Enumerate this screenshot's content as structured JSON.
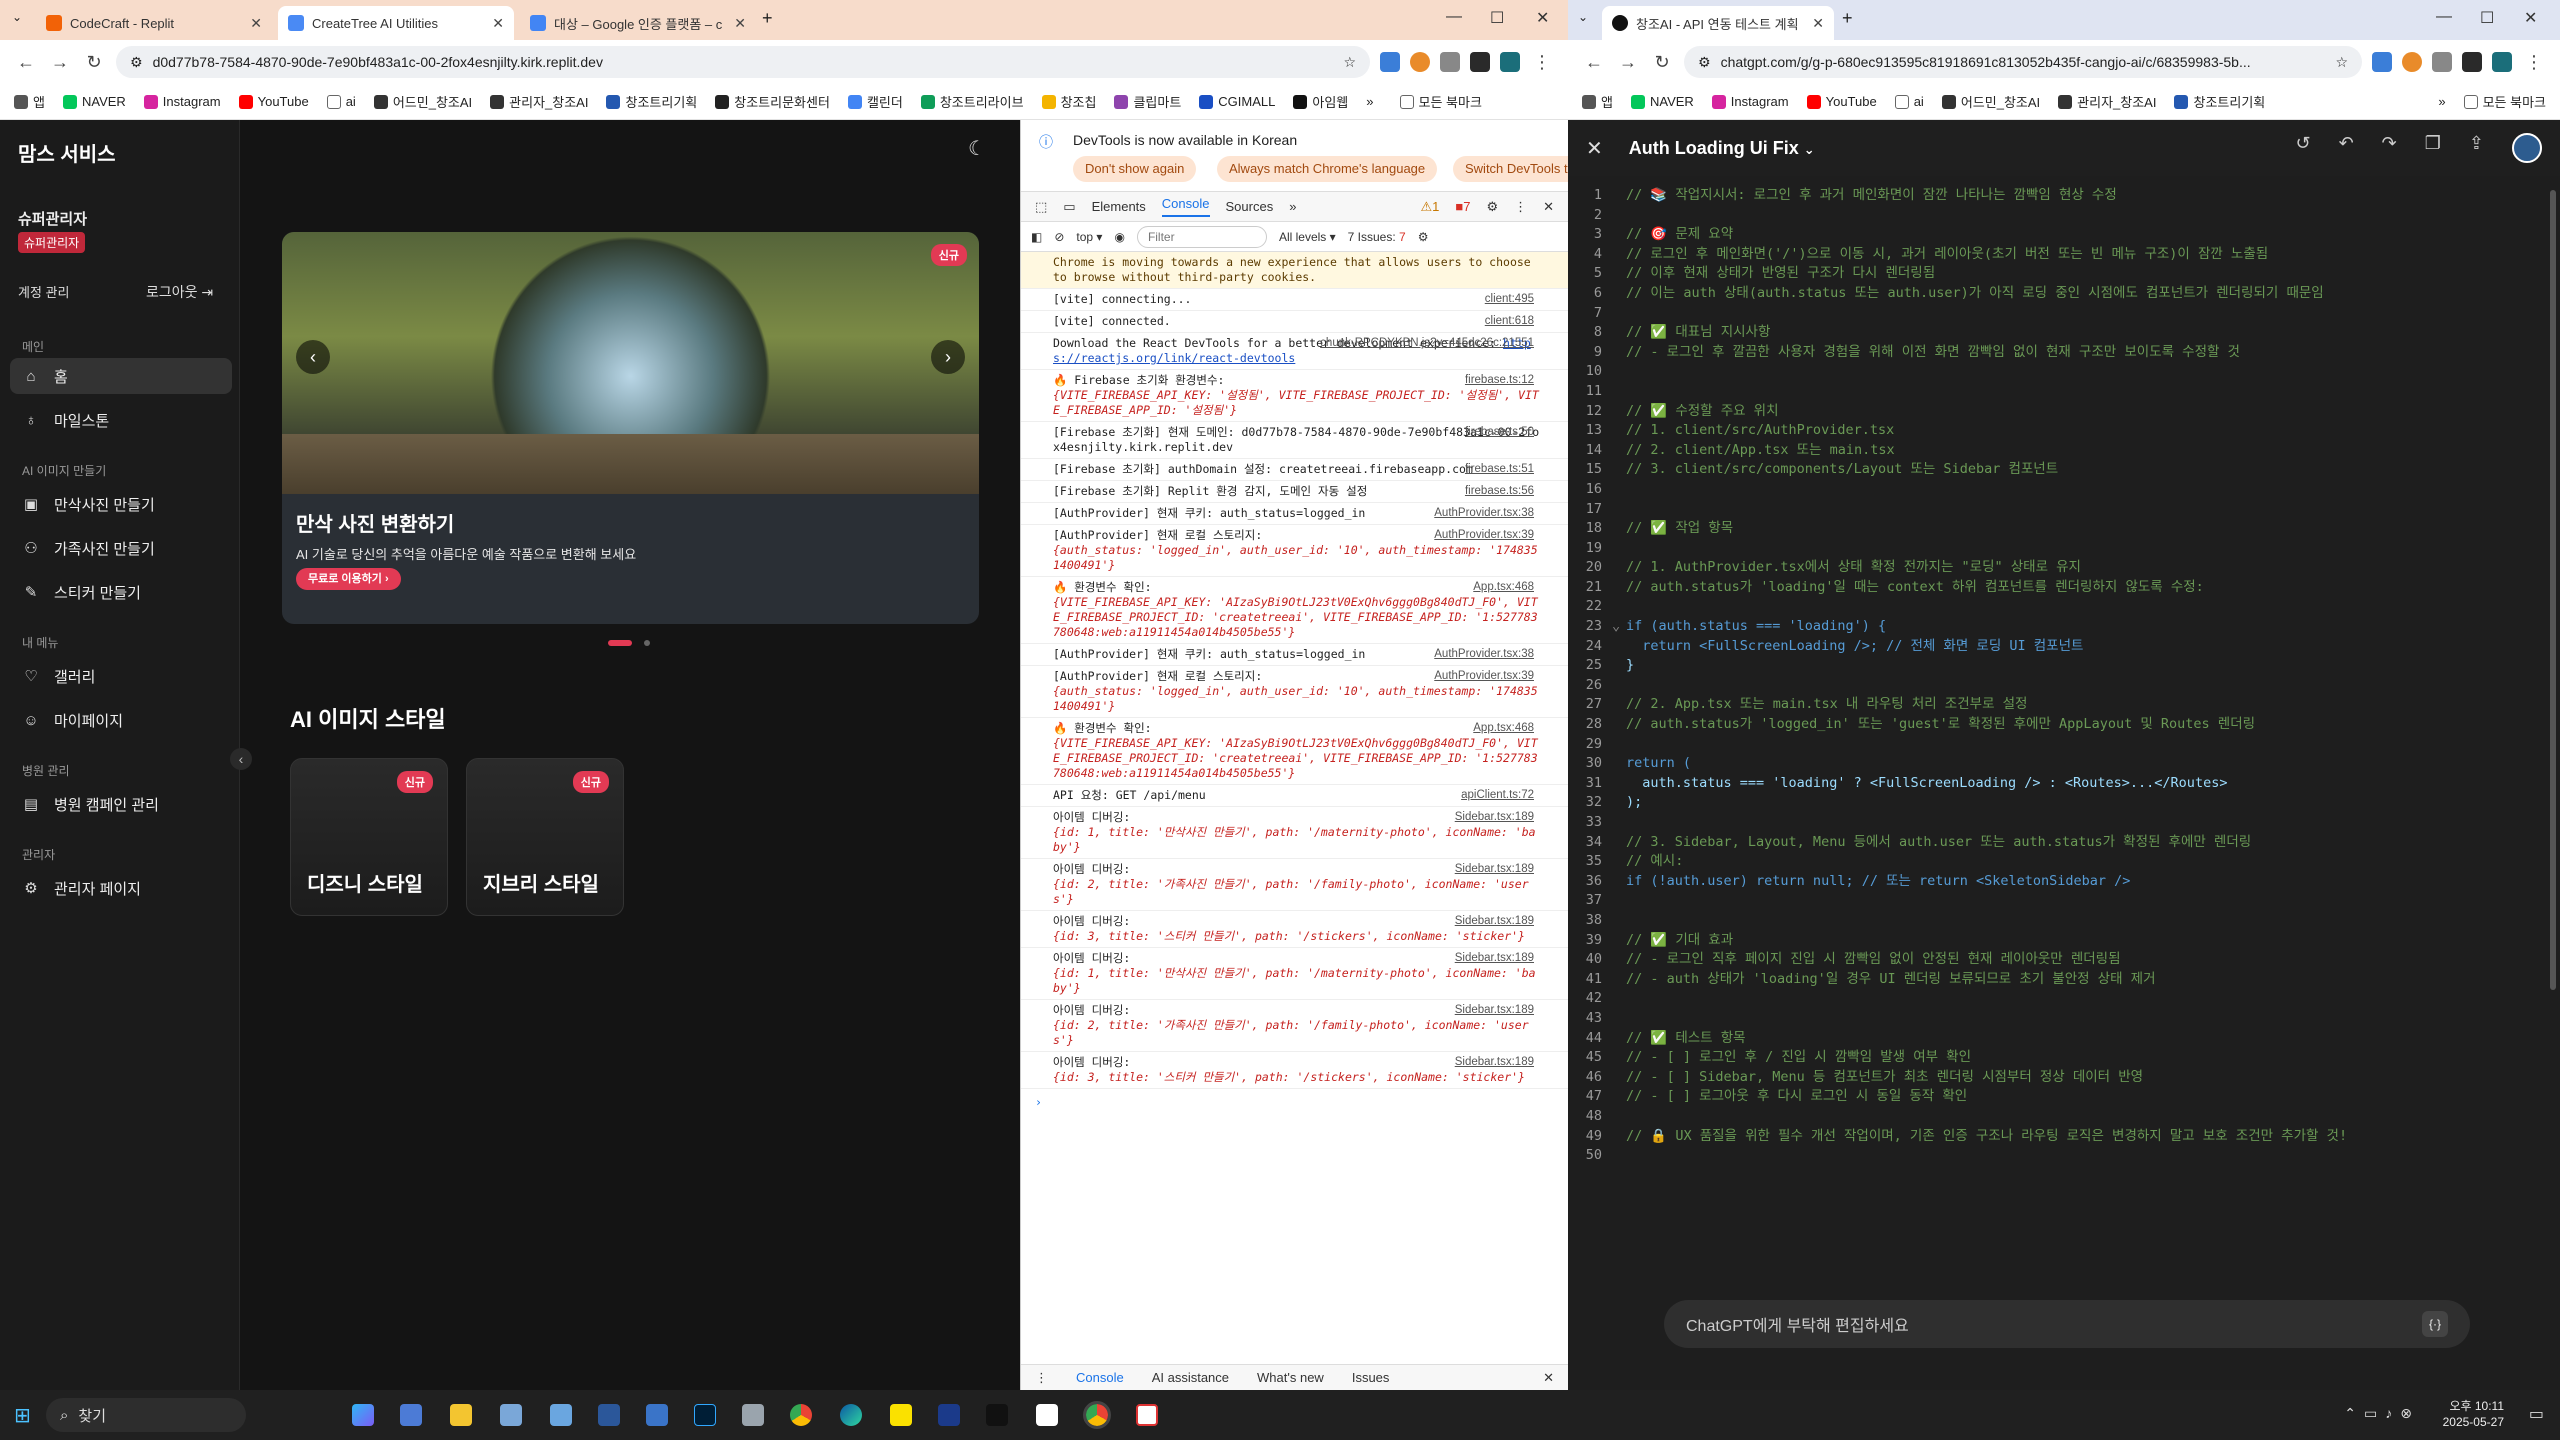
{
  "left_browser": {
    "tabs": [
      {
        "label": "CodeCraft - Replit",
        "color": "#f26207"
      },
      {
        "label": "CreateTree AI Utilities",
        "color": "#4a8af4"
      },
      {
        "label": "대상 – Google 인증 플랫폼 – c",
        "color": "#4285f4"
      }
    ],
    "url": "d0d77b78-7584-4870-90de-7e90bf483a1c-00-2fox4esnjilty.kirk.replit.dev",
    "bookmarks": [
      "앱",
      "NAVER",
      "Instagram",
      "YouTube",
      "ai",
      "어드민_창조AI",
      "관리자_창조AI",
      "창조트리기획",
      "창조트리문화센터",
      "캘린더",
      "창조트리라이브",
      "창조칩",
      "클립마트",
      "CGIMALL",
      "아임웹"
    ],
    "all_bookmarks": "모든 북마크"
  },
  "app": {
    "brand": "맘스 서비스",
    "user_name": "슈퍼관리자",
    "user_role": "슈퍼관리자",
    "account": "계정 관리",
    "logout": "로그아웃",
    "sections": {
      "main": "메인",
      "ai": "AI 이미지 만들기",
      "my": "내 메뉴",
      "hospital": "병원 관리",
      "admin": "관리자"
    },
    "menu": {
      "home": "홈",
      "milestone": "마일스톤",
      "maternity": "만삭사진 만들기",
      "family": "가족사진 만들기",
      "sticker": "스티커 만들기",
      "gallery": "갤러리",
      "mypage": "마이페이지",
      "campaign": "병원 캠페인 관리",
      "adminpage": "관리자 페이지"
    },
    "hero": {
      "badge": "신규",
      "title": "만삭 사진 변환하기",
      "subtitle": "AI 기술로 당신의 추억을 아름다운 예술 작품으로 변환해 보세요",
      "button": "무료로 이용하기 ›",
      "slide_count": 2,
      "active_slide": 1
    },
    "section_title": "AI 이미지 스타일",
    "cards": [
      {
        "badge": "신규",
        "title": "디즈니 스타일"
      },
      {
        "badge": "신규",
        "title": "지브리 스타일"
      }
    ]
  },
  "devtools": {
    "banner": "DevTools is now available in Korean",
    "btn_dont_show": "Don't show again",
    "btn_match": "Always match Chrome's language",
    "btn_switch": "Switch DevTools t",
    "tabs": [
      "Elements",
      "Console",
      "Sources",
      "»"
    ],
    "active_tab": "Console",
    "warn_count": "1",
    "issue_count": "7",
    "context": "top ▾",
    "filter_placeholder": "Filter",
    "levels": "All levels ▾",
    "issues_label": "7 Issues:",
    "messages": [
      {
        "type": "warn",
        "text": "Chrome is moving towards a new experience that allows users to choose to browse without third-party cookies.",
        "src": ""
      },
      {
        "type": "log",
        "text": "[vite] connecting...",
        "src": "client:495"
      },
      {
        "type": "log",
        "text": "[vite] connected.",
        "src": "client:618"
      },
      {
        "type": "log",
        "text": "Download the React DevTools for a better development experience: ",
        "link": "https://reactjs.org/link/react-devtools",
        "src": "chunk-RPCDYKBN.js?v=445dc26c:21551"
      },
      {
        "type": "log",
        "text": "🔥 Firebase 초기화 환경변수:",
        "sub": "{VITE_FIREBASE_API_KEY: '설정됨', VITE_FIREBASE_PROJECT_ID: '설정됨', VITE_FIREBASE_APP_ID: '설정됨'}",
        "src": "firebase.ts:12"
      },
      {
        "type": "log",
        "text": "[Firebase 초기화] 현재 도메인: d0d77b78-7584-4870-90de-7e90bf483a1c-00-2fox4esnjilty.kirk.replit.dev",
        "src": "firebase.ts:50"
      },
      {
        "type": "log",
        "text": "[Firebase 초기화] authDomain 설정: createtreeai.firebaseapp.com",
        "src": "firebase.ts:51"
      },
      {
        "type": "log",
        "text": "[Firebase 초기화] Replit 환경 감지, 도메인 자동 설정",
        "src": "firebase.ts:56"
      },
      {
        "type": "log",
        "text": "[AuthProvider] 현재 쿠키: auth_status=logged_in",
        "src": "AuthProvider.tsx:38"
      },
      {
        "type": "log",
        "text": "[AuthProvider] 현재 로컬 스토리지:",
        "sub": "{auth_status: 'logged_in', auth_user_id: '10', auth_timestamp: '1748351400491'}",
        "src": "AuthProvider.tsx:39"
      },
      {
        "type": "log",
        "text": "🔥 환경변수 확인:",
        "sub": "{VITE_FIREBASE_API_KEY: 'AIzaSyBi9OtLJ23tV0ExQhv6ggg0Bg840dTJ_F0', VITE_FIREBASE_PROJECT_ID: 'createtreeai', VITE_FIREBASE_APP_ID: '1:527783780648:web:a11911454a014b4505be55'}",
        "src": "App.tsx:468"
      },
      {
        "type": "log",
        "text": "[AuthProvider] 현재 쿠키: auth_status=logged_in",
        "src": "AuthProvider.tsx:38"
      },
      {
        "type": "log",
        "text": "[AuthProvider] 현재 로컬 스토리지:",
        "sub": "{auth_status: 'logged_in', auth_user_id: '10', auth_timestamp: '1748351400491'}",
        "src": "AuthProvider.tsx:39"
      },
      {
        "type": "log",
        "text": "🔥 환경변수 확인:",
        "sub": "{VITE_FIREBASE_API_KEY: 'AIzaSyBi9OtLJ23tV0ExQhv6ggg0Bg840dTJ_F0', VITE_FIREBASE_PROJECT_ID: 'createtreeai', VITE_FIREBASE_APP_ID: '1:527783780648:web:a11911454a014b4505be55'}",
        "src": "App.tsx:468"
      },
      {
        "type": "log",
        "text": "API 요청: GET /api/menu",
        "src": "apiClient.ts:72"
      },
      {
        "type": "log",
        "text": "아이템 디버깅:",
        "sub": "{id: 1, title: '만삭사진 만들기', path: '/maternity-photo', iconName: 'baby'}",
        "src": "Sidebar.tsx:189"
      },
      {
        "type": "log",
        "text": "아이템 디버깅:",
        "sub": "{id: 2, title: '가족사진 만들기', path: '/family-photo', iconName: 'users'}",
        "src": "Sidebar.tsx:189"
      },
      {
        "type": "log",
        "text": "아이템 디버깅:",
        "sub": "{id: 3, title: '스티커 만들기', path: '/stickers', iconName: 'sticker'}",
        "src": "Sidebar.tsx:189"
      },
      {
        "type": "log",
        "text": "아이템 디버깅:",
        "sub": "{id: 1, title: '만삭사진 만들기', path: '/maternity-photo', iconName: 'baby'}",
        "src": "Sidebar.tsx:189"
      },
      {
        "type": "log",
        "text": "아이템 디버깅:",
        "sub": "{id: 2, title: '가족사진 만들기', path: '/family-photo', iconName: 'users'}",
        "src": "Sidebar.tsx:189"
      },
      {
        "type": "log",
        "text": "아이템 디버깅:",
        "sub": "{id: 3, title: '스티커 만들기', path: '/stickers', iconName: 'sticker'}",
        "src": "Sidebar.tsx:189"
      }
    ],
    "footer_tabs": [
      "Console",
      "AI assistance",
      "What's new",
      "Issues"
    ]
  },
  "right_browser": {
    "tab": "창조AI - API 연동 테스트 계획",
    "url": "chatgpt.com/g/g-p-680ec913595c81918691c813052b435f-cangjo-ai/c/68359983-5b...",
    "bookmarks": [
      "앱",
      "NAVER",
      "Instagram",
      "YouTube",
      "ai",
      "어드민_창조AI",
      "관리자_창조AI",
      "창조트리기획"
    ],
    "all_bookmarks": "모든 북마크"
  },
  "canvas": {
    "title": "Auth Loading Ui Fix",
    "prompt_placeholder": "ChatGPT에게 부탁해 편집하세요",
    "lines": [
      "// 📚 작업지시서: 로그인 후 과거 메인화면이 잠깐 나타나는 깜빡임 현상 수정",
      "",
      "// 🎯 문제 요약",
      "// 로그인 후 메인화면('/')으로 이동 시, 과거 레이아웃(초기 버전 또는 빈 메뉴 구조)이 잠깐 노출됨",
      "// 이후 현재 상태가 반영된 구조가 다시 렌더링됨",
      "// 이는 auth 상태(auth.status 또는 auth.user)가 아직 로딩 중인 시점에도 컴포넌트가 렌더링되기 때문임",
      "",
      "// ✅ 대표님 지시사항",
      "// - 로그인 후 깔끔한 사용자 경험을 위해 이전 화면 깜빡임 없이 현재 구조만 보이도록 수정할 것",
      "",
      "",
      "// ✅ 수정할 주요 위치",
      "// 1. client/src/AuthProvider.tsx",
      "// 2. client/App.tsx 또는 main.tsx",
      "// 3. client/src/components/Layout 또는 Sidebar 컴포넌트",
      "",
      "",
      "// ✅ 작업 항목",
      "",
      "// 1. AuthProvider.tsx에서 상태 확정 전까지는 \"로딩\" 상태로 유지",
      "// auth.status가 'loading'일 때는 context 하위 컴포넌트를 렌더링하지 않도록 수정:",
      "",
      "if (auth.status === 'loading') {",
      "  return <FullScreenLoading />; // 전체 화면 로딩 UI 컴포넌트",
      "}",
      "",
      "// 2. App.tsx 또는 main.tsx 내 라우팅 처리 조건부로 설정",
      "// auth.status가 'logged_in' 또는 'guest'로 확정된 후에만 AppLayout 및 Routes 렌더링",
      "",
      "return (",
      "  auth.status === 'loading' ? <FullScreenLoading /> : <Routes>...</Routes>",
      ");",
      "",
      "// 3. Sidebar, Layout, Menu 등에서 auth.user 또는 auth.status가 확정된 후에만 렌더링",
      "// 예시:",
      "if (!auth.user) return null; // 또는 return <SkeletonSidebar />",
      "",
      "",
      "// ✅ 기대 효과",
      "// - 로그인 직후 페이지 진입 시 깜빡임 없이 안정된 현재 레이아웃만 렌더링됨",
      "// - auth 상태가 'loading'일 경우 UI 렌더링 보류되므로 초기 불안정 상태 제거",
      "",
      "",
      "// ✅ 테스트 항목",
      "// - [ ] 로그인 후 / 진입 시 깜빡임 발생 여부 확인",
      "// - [ ] Sidebar, Menu 등 컴포넌트가 최초 렌더링 시점부터 정상 데이터 반영",
      "// - [ ] 로그아웃 후 다시 로그인 시 동일 동작 확인",
      "",
      "// 🔒 UX 품질을 위한 필수 개선 작업이며, 기존 인증 구조나 라우팅 로직은 변경하지 말고 보호 조건만 추가할 것!",
      ""
    ]
  },
  "taskbar": {
    "search": "찾기",
    "time": "오후 10:11",
    "date": "2025-05-27"
  }
}
